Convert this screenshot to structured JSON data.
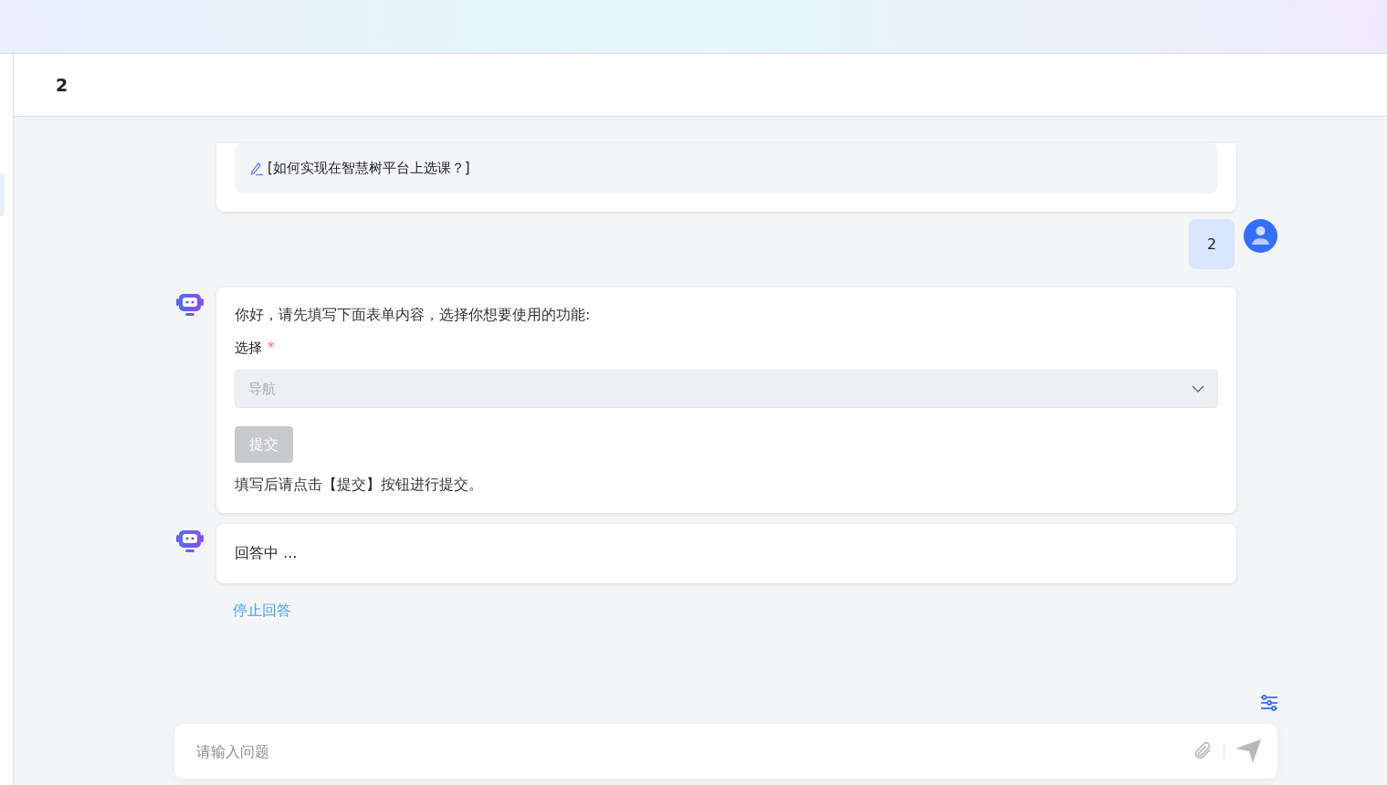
{
  "header": {
    "title": "2"
  },
  "sidebar": {
    "items": [
      {
        "selected": true
      }
    ]
  },
  "messages": [
    {
      "kind": "bot-suggestion",
      "text": "[如何实现在智慧树平台上选课？]"
    },
    {
      "kind": "user",
      "text": "2"
    },
    {
      "kind": "bot-form",
      "intro": "你好，请先填写下面表单内容，选择你想要使用的功能:",
      "field_label": "选择",
      "required": true,
      "required_mark": "*",
      "select_value": "导航",
      "disabled": true,
      "submit": "提交",
      "note": "填写后请点击【提交】按钮进行提交。"
    },
    {
      "kind": "bot-text",
      "text": "回答中 ..."
    }
  ],
  "stop_link": "停止回答",
  "input": {
    "placeholder": "请输入问题"
  }
}
